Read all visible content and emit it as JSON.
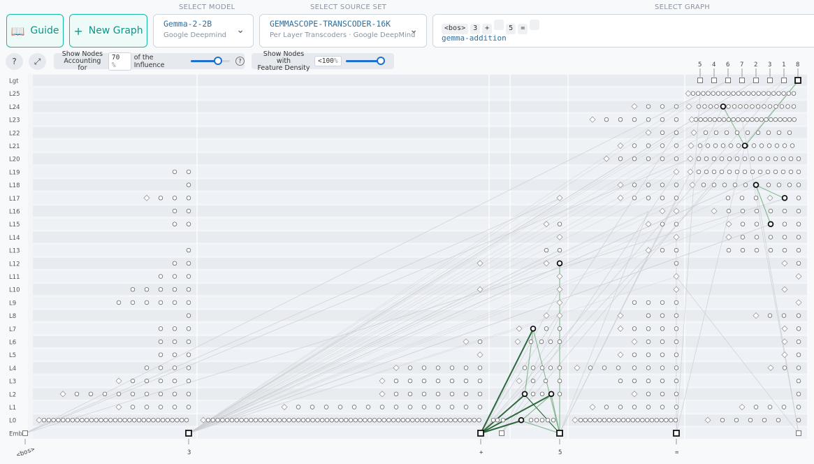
{
  "header": {
    "guide_label": "Guide",
    "new_graph_label": "New Graph",
    "model": {
      "section_label": "SELECT MODEL",
      "name": "Gemma-2-2B",
      "provider": "Google Deepmind"
    },
    "source_set": {
      "section_label": "SELECT SOURCE SET",
      "name": "GEMMASCOPE-TRANSCODER-16K",
      "description": "Per Layer Transcoders · Google DeepMind"
    },
    "graph": {
      "section_label": "SELECT GRAPH",
      "tokens": [
        "<bos>",
        "3",
        "+",
        "",
        "5",
        "=",
        ""
      ],
      "name": "gemma-addition"
    }
  },
  "controls": {
    "help_label": "?",
    "influence_label_1": "Show Nodes",
    "influence_label_2": "Accounting for",
    "influence_value": "70",
    "influence_unit": "%",
    "influence_suffix": "of the Influence",
    "influence_level": 0.7,
    "density_label_1": "Show Nodes with",
    "density_label_2": "Feature Density",
    "density_value": "<100",
    "density_unit": "%",
    "density_level": 1.0
  },
  "graph": {
    "row_labels": [
      "Lgt",
      "L25",
      "L24",
      "L23",
      "L22",
      "L21",
      "L20",
      "L19",
      "L18",
      "L17",
      "L16",
      "L15",
      "L14",
      "L13",
      "L12",
      "L11",
      "L10",
      "L9",
      "L8",
      "L7",
      "L6",
      "L5",
      "L4",
      "L3",
      "L2",
      "L1",
      "L0",
      "Emb"
    ],
    "token_labels": [
      "<bos>",
      "3",
      "+",
      "5",
      "="
    ],
    "logit_labels": [
      "5",
      "4",
      "6",
      "7",
      "2",
      "3",
      "1",
      "8"
    ],
    "colors": {
      "edge_strong": "#1a5c2a",
      "edge_mid": "#4e9a5a",
      "edge_faint": "#c9ccd0",
      "row_band": "#e9ecf1"
    }
  }
}
